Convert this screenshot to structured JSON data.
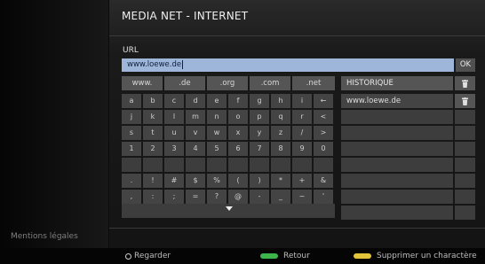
{
  "sidebar": {
    "legal": "Mentions légales"
  },
  "header": {
    "title": "MEDIA NET - INTERNET"
  },
  "url": {
    "label": "URL",
    "value": "www.loewe.de",
    "ok": "OK"
  },
  "domains": [
    "www.",
    ".de",
    ".org",
    ".com",
    ".net"
  ],
  "keyboard": {
    "rows": [
      [
        "a",
        "b",
        "c",
        "d",
        "e",
        "f",
        "g",
        "h",
        "i",
        "←"
      ],
      [
        "j",
        "k",
        "l",
        "m",
        "n",
        "o",
        "p",
        "q",
        "r",
        "<"
      ],
      [
        "s",
        "t",
        "u",
        "v",
        "w",
        "x",
        "y",
        "z",
        "/",
        ">"
      ],
      [
        "1",
        "2",
        "3",
        "4",
        "5",
        "6",
        "7",
        "8",
        "9",
        "0"
      ],
      [
        "",
        "",
        "",
        "",
        "",
        "",
        "",
        "",
        "",
        ""
      ],
      [
        ".",
        "!",
        "#",
        "$",
        "%",
        "(",
        ")",
        "*",
        "+",
        "&"
      ],
      [
        ",",
        ":",
        ";",
        "=",
        "?",
        "@",
        "-",
        "_",
        "~",
        "'"
      ]
    ]
  },
  "history": {
    "header": "HISTORIQUE",
    "items": [
      "www.loewe.de"
    ],
    "empty_rows": 7
  },
  "footer": {
    "watch": "Regarder",
    "back": "Retour",
    "delete": "Supprimer un charactère"
  },
  "colors": {
    "green_key": "#3db54a",
    "yellow_key": "#e3c53a",
    "input_bg": "#9db6d9"
  },
  "icons": {
    "history_delete": "trash-icon",
    "footer_watch": "rotate-icon"
  }
}
